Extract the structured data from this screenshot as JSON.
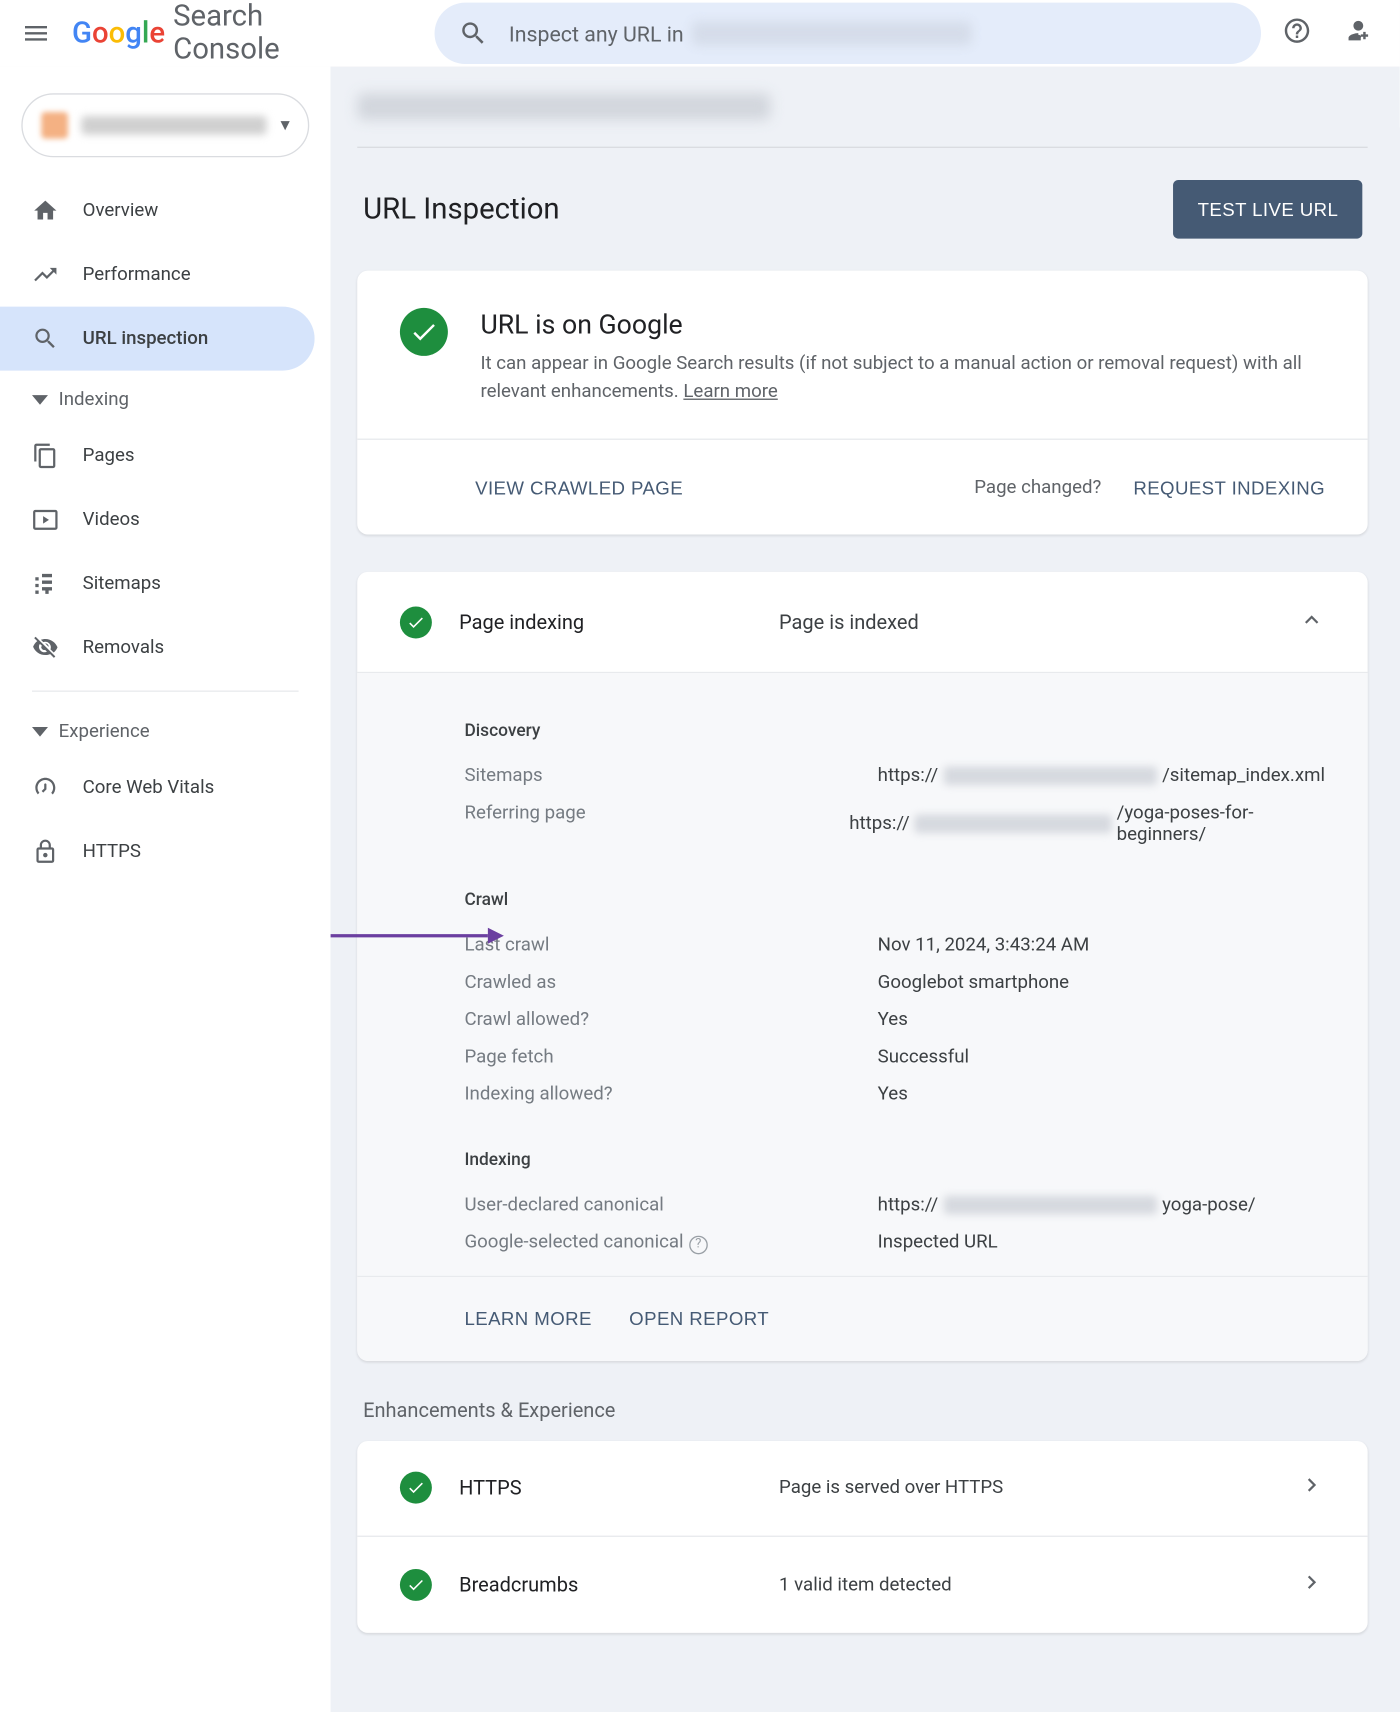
{
  "header": {
    "logo_suffix": "Search Console",
    "search_placeholder": "Inspect any URL in"
  },
  "sidebar": {
    "nav": [
      {
        "label": "Overview"
      },
      {
        "label": "Performance"
      },
      {
        "label": "URL inspection"
      }
    ],
    "section_indexing": "Indexing",
    "indexing_items": [
      {
        "label": "Pages"
      },
      {
        "label": "Videos"
      },
      {
        "label": "Sitemaps"
      },
      {
        "label": "Removals"
      }
    ],
    "section_experience": "Experience",
    "experience_items": [
      {
        "label": "Core Web Vitals"
      },
      {
        "label": "HTTPS"
      }
    ]
  },
  "page": {
    "title": "URL Inspection",
    "test_btn": "TEST LIVE URL"
  },
  "status": {
    "title": "URL is on Google",
    "desc": "It can appear in Google Search results (if not subject to a manual action or removal request) with all relevant enhancements. ",
    "learn_more": "Learn more",
    "view_crawled": "VIEW CRAWLED PAGE",
    "page_changed": "Page changed?",
    "request_indexing": "REQUEST INDEXING"
  },
  "indexing": {
    "head_label": "Page indexing",
    "head_status": "Page is indexed",
    "discovery": {
      "title": "Discovery",
      "sitemaps_k": "Sitemaps",
      "sitemaps_pre": "https://",
      "sitemaps_post": "/sitemap_index.xml",
      "referring_k": "Referring page",
      "referring_pre": "https://",
      "referring_post": "/yoga-poses-for-beginners/"
    },
    "crawl": {
      "title": "Crawl",
      "last_crawl_k": "Last crawl",
      "last_crawl_v": "Nov 11, 2024, 3:43:24 AM",
      "crawled_as_k": "Crawled as",
      "crawled_as_v": "Googlebot smartphone",
      "crawl_allowed_k": "Crawl allowed?",
      "crawl_allowed_v": "Yes",
      "page_fetch_k": "Page fetch",
      "page_fetch_v": "Successful",
      "indexing_allowed_k": "Indexing allowed?",
      "indexing_allowed_v": "Yes"
    },
    "idx": {
      "title": "Indexing",
      "user_canon_k": "User-declared canonical",
      "user_canon_pre": "https://",
      "user_canon_post": "yoga-pose/",
      "google_canon_k": "Google-selected canonical",
      "google_canon_v": "Inspected URL"
    },
    "learn_more": "LEARN MORE",
    "open_report": "OPEN REPORT"
  },
  "enhancements": {
    "title": "Enhancements & Experience",
    "rows": [
      {
        "label": "HTTPS",
        "status": "Page is served over HTTPS"
      },
      {
        "label": "Breadcrumbs",
        "status": "1 valid item detected"
      }
    ]
  }
}
